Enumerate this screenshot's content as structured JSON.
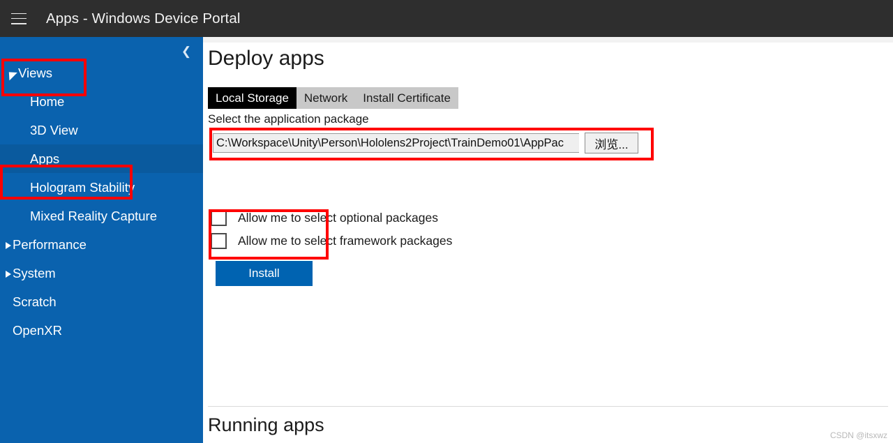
{
  "titlebar": {
    "menu_icon": "hamburger-icon",
    "title": "Apps - Windows Device Portal"
  },
  "sidebar": {
    "collapse_icon": "chevron-left-icon",
    "background_color": "#0a62ae",
    "selected_item": "Apps",
    "groups": [
      {
        "label": "Views",
        "expanded": true,
        "triangle": "triangle-expanded-icon",
        "items": [
          {
            "label": "Home",
            "selected": false
          },
          {
            "label": "3D View",
            "selected": false
          },
          {
            "label": "Apps",
            "selected": true
          },
          {
            "label": "Hologram Stability",
            "selected": false
          },
          {
            "label": "Mixed Reality Capture",
            "selected": false
          }
        ]
      },
      {
        "label": "Performance",
        "expanded": false,
        "triangle": "triangle-collapsed-icon",
        "items": []
      },
      {
        "label": "System",
        "expanded": false,
        "triangle": "triangle-collapsed-icon",
        "items": []
      }
    ],
    "standalone_items": [
      {
        "label": "Scratch"
      },
      {
        "label": "OpenXR"
      }
    ]
  },
  "main": {
    "page_title": "Deploy apps",
    "tabs": [
      {
        "label": "Local Storage",
        "active": true
      },
      {
        "label": "Network",
        "active": false
      },
      {
        "label": "Install Certificate",
        "active": false
      }
    ],
    "package_field_label": "Select the application package",
    "path_value": "C:\\Workspace\\Unity\\Person\\Hololens2Project\\TrainDemo01\\AppPac",
    "path_placeholder": "",
    "browse_label": "浏览...",
    "checkboxes": [
      {
        "label": "Allow me to select optional packages",
        "checked": false
      },
      {
        "label": "Allow me to select framework packages",
        "checked": false
      }
    ],
    "install_label": "Install",
    "install_color": "#0063b1",
    "running_apps_title": "Running apps"
  },
  "annotations": {
    "color": "#ff0000",
    "boxes": [
      "views-group",
      "apps-item",
      "package-path-row",
      "install-button"
    ]
  },
  "watermark": "CSDN @itsxwz"
}
